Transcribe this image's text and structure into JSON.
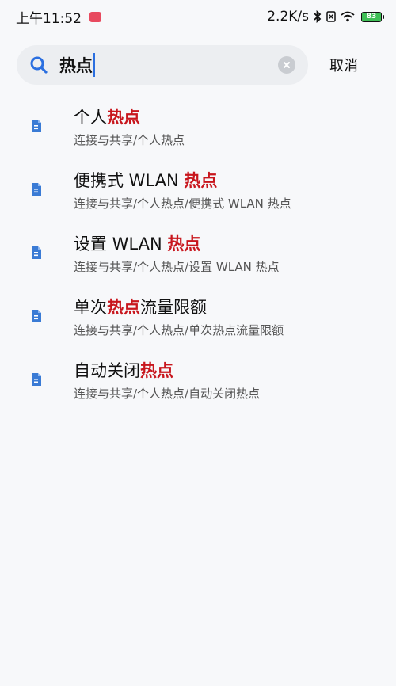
{
  "status_bar": {
    "time": "上午11:52",
    "net_speed": "2.2K/s",
    "battery": "83"
  },
  "search": {
    "query": "热点",
    "cancel_label": "取消"
  },
  "results": [
    {
      "title_pre": "个人",
      "title_hl": "热点",
      "title_post": "",
      "path": "连接与共享/个人热点"
    },
    {
      "title_pre": "便携式 WLAN ",
      "title_hl": "热点",
      "title_post": "",
      "path": "连接与共享/个人热点/便携式 WLAN 热点"
    },
    {
      "title_pre": "设置 WLAN ",
      "title_hl": "热点",
      "title_post": "",
      "path": "连接与共享/个人热点/设置 WLAN 热点"
    },
    {
      "title_pre": "单次",
      "title_hl": "热点",
      "title_post": "流量限额",
      "path": "连接与共享/个人热点/单次热点流量限额"
    },
    {
      "title_pre": "自动关闭",
      "title_hl": "热点",
      "title_post": "",
      "path": "连接与共享/个人热点/自动关闭热点"
    }
  ],
  "colors": {
    "highlight": "#c8161d",
    "accent": "#2b6fe0",
    "icon_blue": "#3a7bd5"
  }
}
